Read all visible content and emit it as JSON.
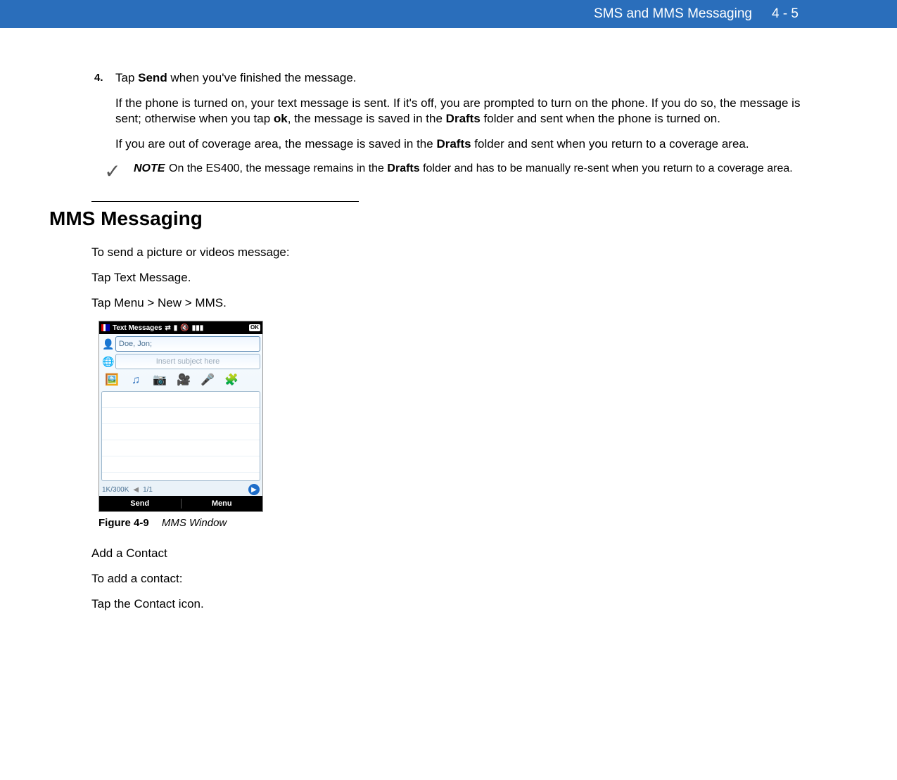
{
  "header": {
    "title": "SMS and MMS Messaging",
    "page": "4 - 5"
  },
  "step4": {
    "number": "4.",
    "line1_pre": "Tap ",
    "line1_bold": "Send",
    "line1_post": " when you've finished the message.",
    "para2_a": "If the phone is turned on, your text message is sent. If it's off, you are prompted to turn on the phone. If you do so, the message is sent; otherwise when you tap ",
    "para2_b1": "ok",
    "para2_c": ", the message is saved in the ",
    "para2_b2": "Drafts",
    "para2_d": " folder and sent when the phone is turned on.",
    "para3_a": "If you are out of coverage area, the message is saved in the ",
    "para3_b": "Drafts",
    "para3_c": " folder and sent when you return to a coverage area."
  },
  "note": {
    "label": "NOTE",
    "text_a": "On the ES400, the message remains in the ",
    "text_b": "Drafts",
    "text_c": " folder and has to be manually re-sent when you return to a coverage area."
  },
  "section_heading": "MMS Messaging",
  "subtext": {
    "p1": "To send a picture or videos message:",
    "p2": "Tap Text Message.",
    "p3": "Tap Menu > New > MMS."
  },
  "phone": {
    "title": "Text Messages",
    "ok": "OK",
    "to_value": "Doe, Jon;",
    "subject_placeholder": "Insert subject here",
    "size": "1K/300K",
    "page": "1/1",
    "softkey_left": "Send",
    "softkey_right": "Menu"
  },
  "figure": {
    "label": "Figure 4-9",
    "title": "MMS Window"
  },
  "after": {
    "p1": "Add a Contact",
    "p2": "To add a contact:",
    "p3": "Tap the Contact icon."
  }
}
